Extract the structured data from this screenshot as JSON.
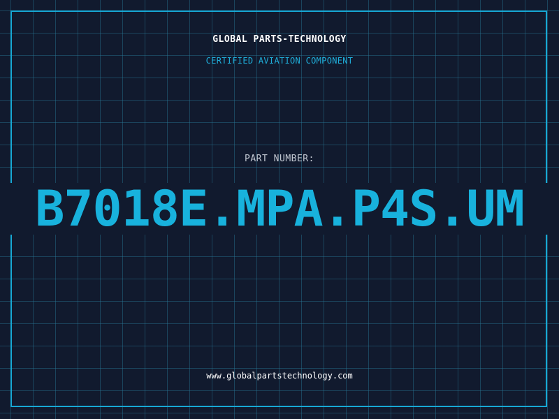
{
  "card": {
    "company": "GLOBAL PARTS-TECHNOLOGY",
    "subtitle": "CERTIFIED AVIATION COMPONENT",
    "part_number_label": "PART NUMBER:",
    "part_number": "B7018E.MPA.P4S.UM",
    "website": "www.globalpartstechnology.com"
  },
  "colors": {
    "background": "#111a2e",
    "grid": "#287896",
    "accent": "#18b2dd",
    "text": "#ffffff"
  }
}
